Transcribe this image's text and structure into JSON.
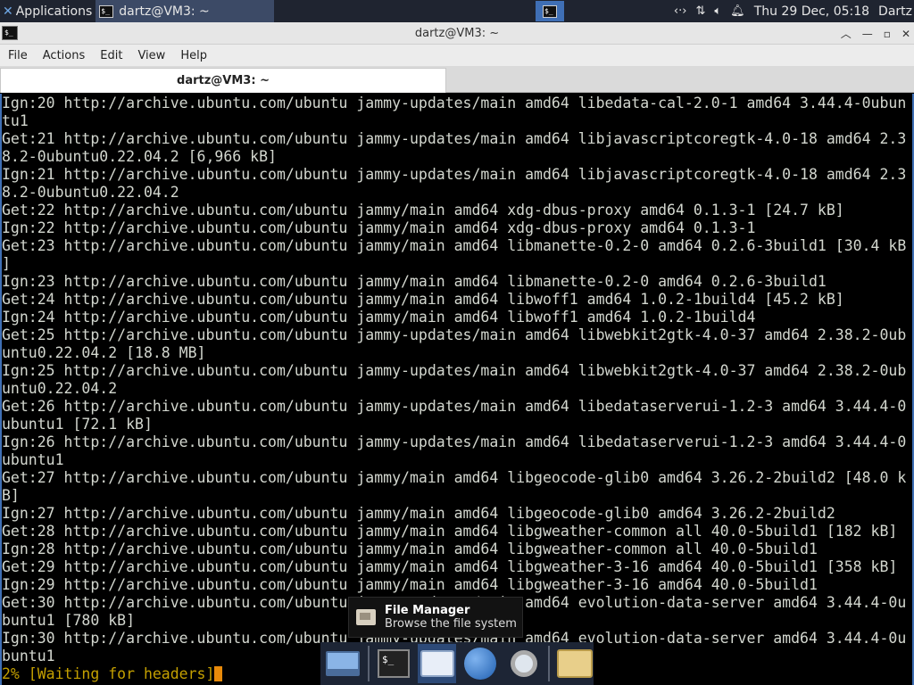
{
  "top_panel": {
    "apps_label": "Applications",
    "task_label": "dartz@VM3: ~",
    "clock": "Thu 29 Dec, 05:18",
    "user": "Dartz",
    "tray_icons": [
      "network-icon",
      "transfer-icon",
      "volume-icon",
      "notification-bell-icon"
    ]
  },
  "window": {
    "title": "dartz@VM3: ~",
    "tab_label": "dartz@VM3: ~"
  },
  "menu": [
    "File",
    "Actions",
    "Edit",
    "View",
    "Help"
  ],
  "terminal": {
    "lines": [
      "Ign:20 http://archive.ubuntu.com/ubuntu jammy-updates/main amd64 libedata-cal-2.0-1 amd64 3.44.4-0ubun",
      "tu1",
      "Get:21 http://archive.ubuntu.com/ubuntu jammy-updates/main amd64 libjavascriptcoregtk-4.0-18 amd64 2.3",
      "8.2-0ubuntu0.22.04.2 [6,966 kB]",
      "Ign:21 http://archive.ubuntu.com/ubuntu jammy-updates/main amd64 libjavascriptcoregtk-4.0-18 amd64 2.3",
      "8.2-0ubuntu0.22.04.2",
      "Get:22 http://archive.ubuntu.com/ubuntu jammy/main amd64 xdg-dbus-proxy amd64 0.1.3-1 [24.7 kB]",
      "Ign:22 http://archive.ubuntu.com/ubuntu jammy/main amd64 xdg-dbus-proxy amd64 0.1.3-1",
      "Get:23 http://archive.ubuntu.com/ubuntu jammy/main amd64 libmanette-0.2-0 amd64 0.2.6-3build1 [30.4 kB",
      "]",
      "Ign:23 http://archive.ubuntu.com/ubuntu jammy/main amd64 libmanette-0.2-0 amd64 0.2.6-3build1",
      "Get:24 http://archive.ubuntu.com/ubuntu jammy/main amd64 libwoff1 amd64 1.0.2-1build4 [45.2 kB]",
      "Ign:24 http://archive.ubuntu.com/ubuntu jammy/main amd64 libwoff1 amd64 1.0.2-1build4",
      "Get:25 http://archive.ubuntu.com/ubuntu jammy-updates/main amd64 libwebkit2gtk-4.0-37 amd64 2.38.2-0ub",
      "untu0.22.04.2 [18.8 MB]",
      "Ign:25 http://archive.ubuntu.com/ubuntu jammy-updates/main amd64 libwebkit2gtk-4.0-37 amd64 2.38.2-0ub",
      "untu0.22.04.2",
      "Get:26 http://archive.ubuntu.com/ubuntu jammy-updates/main amd64 libedataserverui-1.2-3 amd64 3.44.4-0",
      "ubuntu1 [72.1 kB]",
      "Ign:26 http://archive.ubuntu.com/ubuntu jammy-updates/main amd64 libedataserverui-1.2-3 amd64 3.44.4-0",
      "ubuntu1",
      "Get:27 http://archive.ubuntu.com/ubuntu jammy/main amd64 libgeocode-glib0 amd64 3.26.2-2build2 [48.0 k",
      "B]",
      "Ign:27 http://archive.ubuntu.com/ubuntu jammy/main amd64 libgeocode-glib0 amd64 3.26.2-2build2",
      "Get:28 http://archive.ubuntu.com/ubuntu jammy/main amd64 libgweather-common all 40.0-5build1 [182 kB]",
      "Ign:28 http://archive.ubuntu.com/ubuntu jammy/main amd64 libgweather-common all 40.0-5build1",
      "Get:29 http://archive.ubuntu.com/ubuntu jammy/main amd64 libgweather-3-16 amd64 40.0-5build1 [358 kB]",
      "Ign:29 http://archive.ubuntu.com/ubuntu jammy/main amd64 libgweather-3-16 amd64 40.0-5build1",
      "Get:30 http://archive.ubuntu.com/ubuntu jammy-updates/main amd64 evolution-data-server amd64 3.44.4-0u",
      "buntu1 [780 kB]",
      "Ign:30 http://archive.ubuntu.com/ubuntu jammy-updates/main amd64 evolution-data-server amd64 3.44.4-0u",
      "buntu1"
    ],
    "progress_line": "2% [Waiting for headers]"
  },
  "tooltip": {
    "title": "File Manager",
    "description": "Browse the file system"
  },
  "dock": {
    "items": [
      "show-desktop-icon",
      "terminal-icon",
      "file-manager-icon",
      "web-browser-icon",
      "app-finder-icon",
      "files-icon"
    ]
  }
}
